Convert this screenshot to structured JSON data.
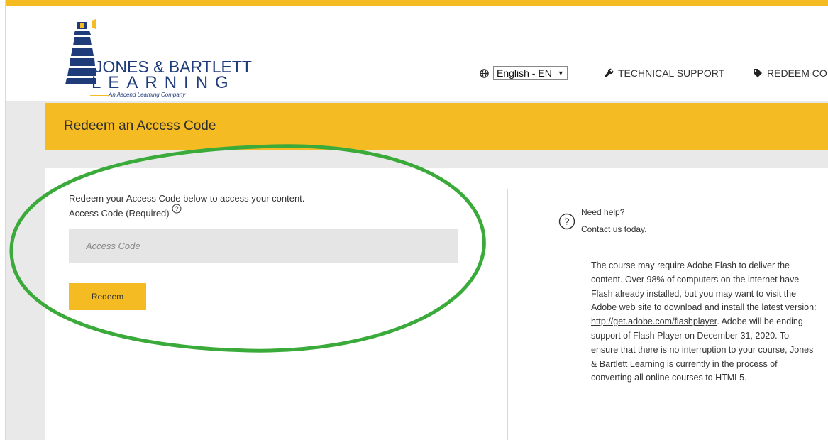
{
  "brand": {
    "name_line1": "JONES & BARTLETT",
    "name_line2": "LEARNING",
    "tagline": "An Ascend Learning Company"
  },
  "header": {
    "language": "English - EN",
    "tech_support": "TECHNICAL SUPPORT",
    "redeem_code": "REDEEM COI"
  },
  "page": {
    "title": "Redeem an Access Code"
  },
  "form": {
    "intro": "Redeem your Access Code below to access your content.",
    "code_label": "Access Code (Required)",
    "code_placeholder": "Access Code",
    "code_value": "",
    "redeem_label": "Redeem"
  },
  "help": {
    "need_help": "Need help?",
    "contact": "Contact us today.",
    "flash_before": "The course may require Adobe Flash to deliver the content. Over 98% of computers on the internet have Flash already installed, but you may want to visit the Adobe web site to download and install the latest version: ",
    "flash_link": "http://get.adobe.com/flashplayer",
    "flash_after": ". Adobe will be ending support of Flash Player on December 31, 2020. To ensure that there is no interruption to your course, Jones & Bartlett Learning is currently in the process of converting all online courses to HTML5."
  },
  "colors": {
    "accent": "#f5bb23",
    "brand_blue": "#1f3b7a",
    "annotation_green": "#3aaa3a"
  },
  "icons": {
    "lighthouse": "lighthouse-logo",
    "globe": "globe-icon",
    "wrench": "wrench-icon",
    "tag": "tag-icon",
    "question": "question-circle-icon"
  }
}
